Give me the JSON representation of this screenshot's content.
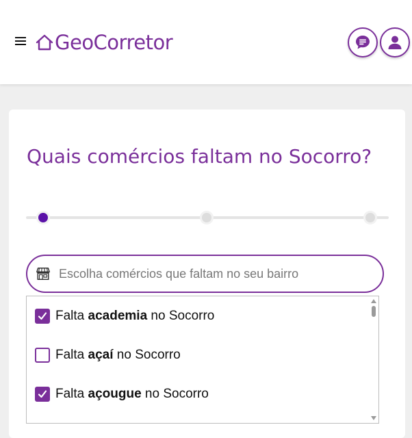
{
  "header": {
    "logo_text": "GeoCorretor",
    "menu_icon": "hamburger-menu-icon",
    "chat_icon": "chat-bubble-icon",
    "user_icon": "user-profile-icon",
    "brand_color": "#7a2f9a"
  },
  "form": {
    "question": "Quais comércios faltam no Socorro?",
    "progress": {
      "steps": 3,
      "current_step": 1,
      "active_color": "#5b12a8"
    },
    "search": {
      "placeholder": "Escolha comércios que faltam no seu bairro",
      "value": "",
      "icon": "store-icon"
    },
    "options": [
      {
        "prefix": "Falta ",
        "item": "academia",
        "suffix": " no Socorro",
        "checked": true
      },
      {
        "prefix": "Falta ",
        "item": "açaí",
        "suffix": " no Socorro",
        "checked": false
      },
      {
        "prefix": "Falta ",
        "item": "açougue",
        "suffix": " no Socorro",
        "checked": true
      }
    ]
  }
}
